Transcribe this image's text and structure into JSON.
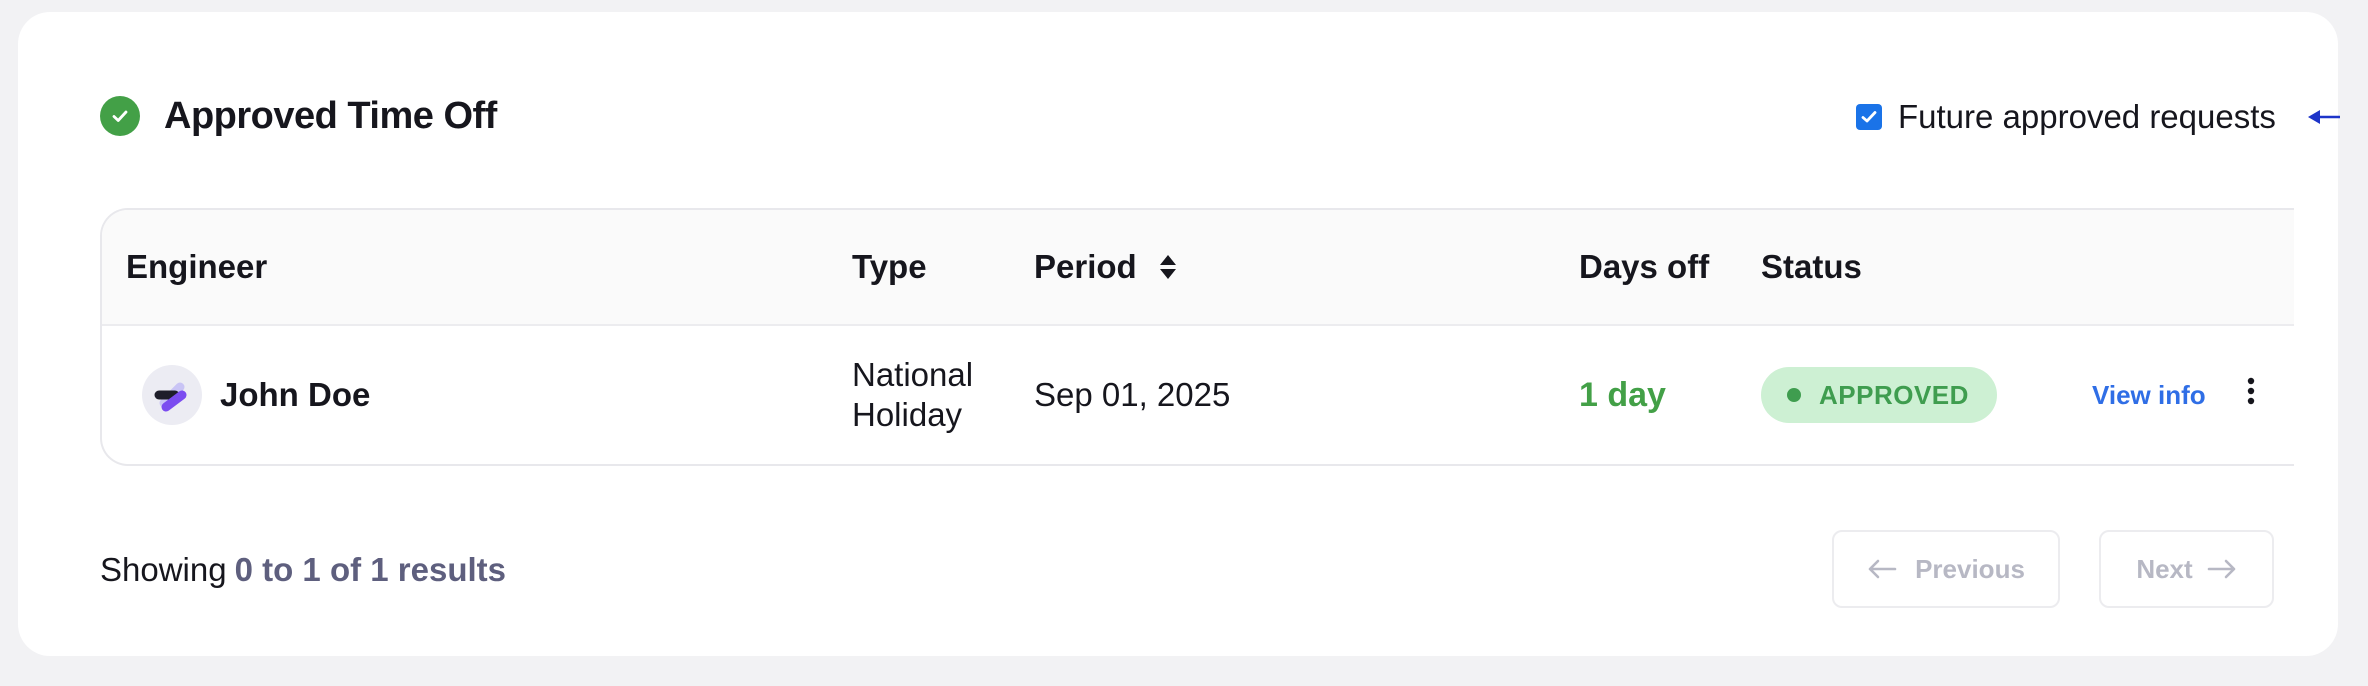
{
  "header": {
    "title": "Approved Time Off",
    "future_label": "Future approved requests",
    "future_checked": true
  },
  "table": {
    "columns": [
      "Engineer",
      "Type",
      "Period",
      "Days off",
      "Status"
    ],
    "rows": [
      {
        "engineer": "John Doe",
        "type_line1": "National",
        "type_line2": "Holiday",
        "period": "Sep 01, 2025",
        "days_off": "1 day",
        "status": "APPROVED",
        "action": "View info"
      }
    ]
  },
  "footer": {
    "showing_prefix": "Showing",
    "showing_range": "0 to 1 of 1 results",
    "previous_label": "Previous",
    "next_label": "Next"
  },
  "colors": {
    "accent_green": "#43a047",
    "status_bg": "#cdf0d3",
    "link_blue": "#2f6ee6",
    "checkbox_blue": "#1a73e8"
  }
}
